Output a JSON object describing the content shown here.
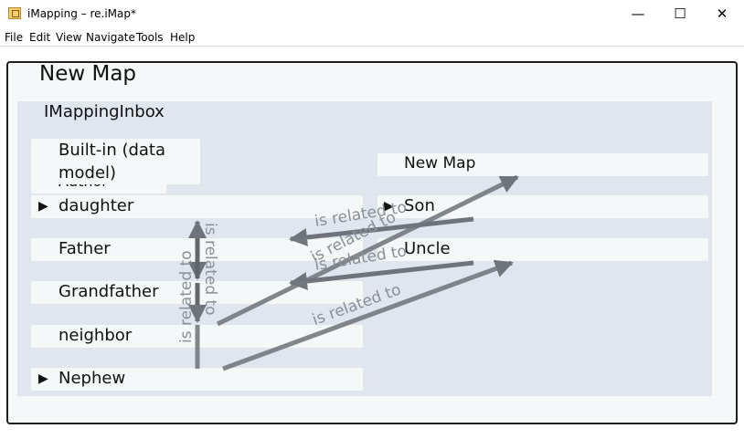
{
  "window": {
    "title": "iMapping – re.iMap*",
    "minimize": "—",
    "maximize": "☐",
    "close": "✕"
  },
  "menu": [
    "File",
    "Edit",
    "View",
    "Navigate",
    "Tools",
    "Help"
  ],
  "map": {
    "title": "New Map",
    "inbox": {
      "title": "IMappingInbox",
      "items": {
        "author": "Author",
        "builtin": "Built-in (data model)",
        "daughter": "daughter",
        "father": "Father",
        "grandfather": "Grandfather",
        "neighbor": "neighbor",
        "nephew": "Nephew",
        "newmap": "New Map",
        "son": "Son",
        "uncle": "Uncle"
      },
      "expand_glyph": "▶"
    },
    "relation_label": "is related to",
    "colors": {
      "edge": "#6e7378",
      "inbox_bg": "#dfe6ee",
      "item_bg": "#f4f8f8"
    }
  }
}
